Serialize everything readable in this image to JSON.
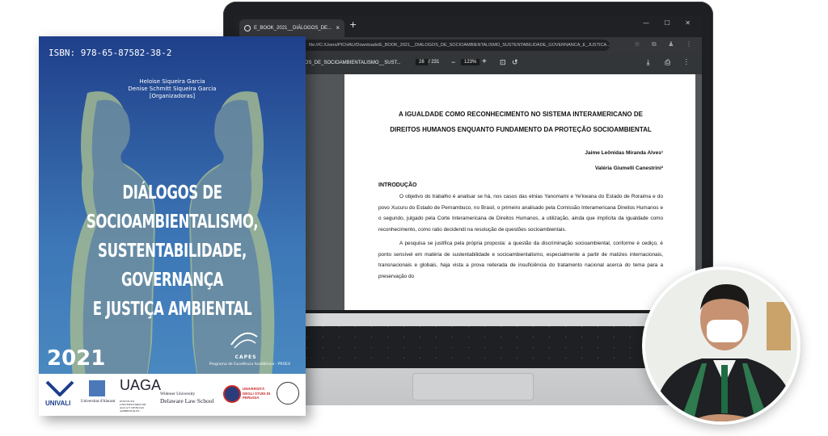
{
  "browser": {
    "tab_title": "E_BOOK_2021__DIÁLOGOS_DE...",
    "tab_close": "×",
    "new_tab": "+",
    "nav_icons": "← → ↻",
    "url": "file:///C:/Users/PICHAU/Downloads/E_BOOK_2021__DIALOGOS_DE_SOCIOAMBIENTALISMO_SUSTENTABILIDADE_GOVERNANCA_E_JUSTICA...",
    "window_controls": "— ☐ ✕"
  },
  "pdf_viewer": {
    "file_title": "LOGOS_DE_SOCIOAMBIENTALISMO__SUST...",
    "current_page": "28",
    "total_pages": "/ 231",
    "zoom": "123%",
    "zoom_minus": "−",
    "zoom_plus": "+"
  },
  "document": {
    "title_line1": "A IGUALDADE COMO RECONHECIMENTO NO SISTEMA INTERAMERICANO DE",
    "title_line2": "DIREITOS HUMANOS ENQUANTO FUNDAMENTO DA PROTEÇÃO SOCIOAMBIENTAL",
    "author1": "Jaime Leônidas Miranda Alves¹",
    "author2": "Valéria Giumelli Canestrini²",
    "section_heading": "INTRODUÇÃO",
    "paragraph1": "O objetivo do trabalho é analisar se há, nos casos das etnias Yanomami e Ye'kwana do Estado de Roraima e do povo Xucuru do Estado de Pernambuco, no Brasil, o primeiro analisado pela Comissão Interamericana Direitos Humanos e o segundo, julgado pela Corte Interamericana de Direitos Humanos, a utilização, ainda que implícita da igualdade como reconhecimento, como ratio decidendi na resolução de questões socioambientais.",
    "paragraph2": "A pesquisa se justifica pela própria proposta: a questão da discriminação socioambiental, conforme é cediço, é ponto sensível em matéria de sustentabilidade e socioambientalismo, especialmente a partir de matizes internacionais, transnacionais e globais, haja vista a prova reiterada de insuficiência do tratamento nacional acerca do tema para a preservação do"
  },
  "book_cover": {
    "isbn": "ISBN: 978-65-87582-38-2",
    "editor1": "Heloise Siqueira Garcia",
    "editor2": "Denise Schmitt Siqueira Garcia",
    "editors_role": "[Organizadoras]",
    "title_line1": "DIÁLOGOS DE SOCIOAMBIENTALISMO,",
    "title_line2": "SUSTENTABILIDADE, GOVERNANÇA",
    "title_line3": "E JUSTIÇA AMBIENTAL",
    "year": "2021",
    "capes": "CAPES",
    "capes_program": "Programa de Excelência Acadêmica - PROEX",
    "logos": {
      "univali": "UNIVALI",
      "alicante": "Universitat d'Alacant",
      "uaga": "UAGA",
      "uaga_sub": "INSTITUTO UNIVERSITÁRIO DE AGUA Y CIENCIAS AMBIENTALES",
      "widener1": "Widener University",
      "widener2": "Delaware Law School",
      "perugia": "UNIVERSITÀ DEGLI STUDI DI PERUGIA"
    },
    "colors": {
      "cover_top": "#1f3f8a",
      "cover_bottom": "#4e8ec4",
      "silhouette": "#7fa89a"
    }
  },
  "presenter": {
    "icon": "presenter-avatar-icon"
  }
}
